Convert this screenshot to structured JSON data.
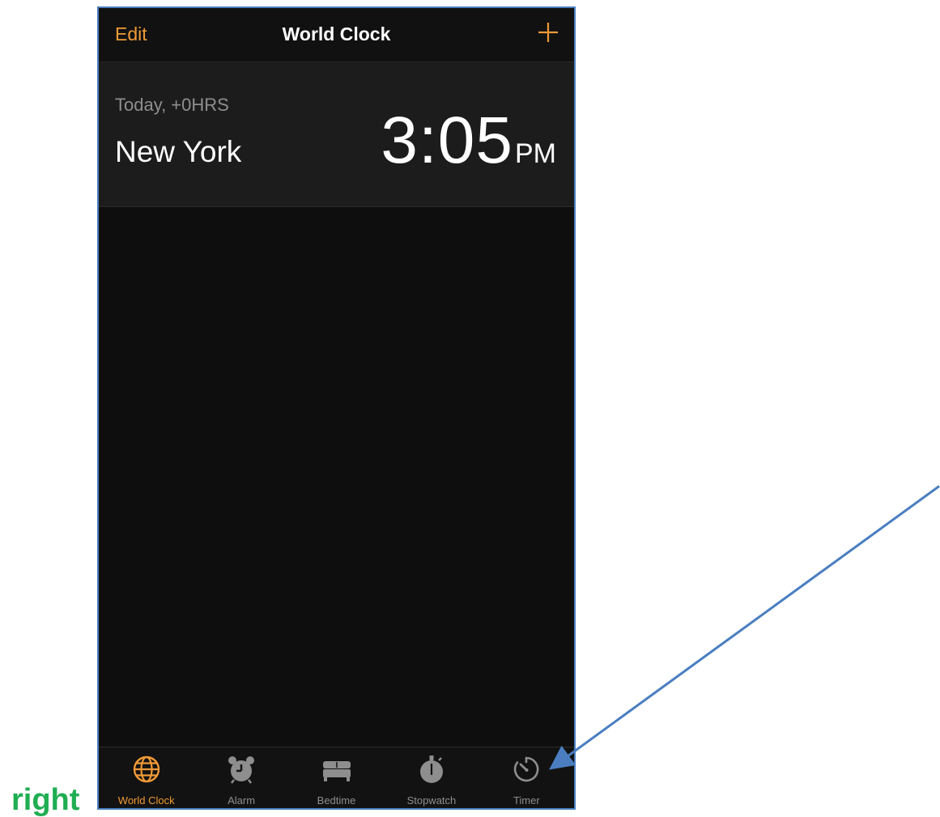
{
  "nav": {
    "edit_label": "Edit",
    "title": "World Clock",
    "add_icon": "plus-icon"
  },
  "clock": {
    "offset_label": "Today, +0HRS",
    "city": "New York",
    "time": "3:05",
    "ampm": "PM"
  },
  "tabs": [
    {
      "label": "World Clock",
      "icon": "globe-icon",
      "active": true
    },
    {
      "label": "Alarm",
      "icon": "alarm-clock-icon",
      "active": false
    },
    {
      "label": "Bedtime",
      "icon": "bed-icon",
      "active": false
    },
    {
      "label": "Stopwatch",
      "icon": "stopwatch-icon",
      "active": false
    },
    {
      "label": "Timer",
      "icon": "timer-icon",
      "active": false
    }
  ],
  "annotation": {
    "side_label": "right"
  },
  "colors": {
    "accent": "#f09a37",
    "inactive": "#8e8e8e",
    "background": "#0e0e0e",
    "frame_border": "#4a7ec0",
    "arrow": "#4a7ec0",
    "side_label": "#1fae52"
  }
}
